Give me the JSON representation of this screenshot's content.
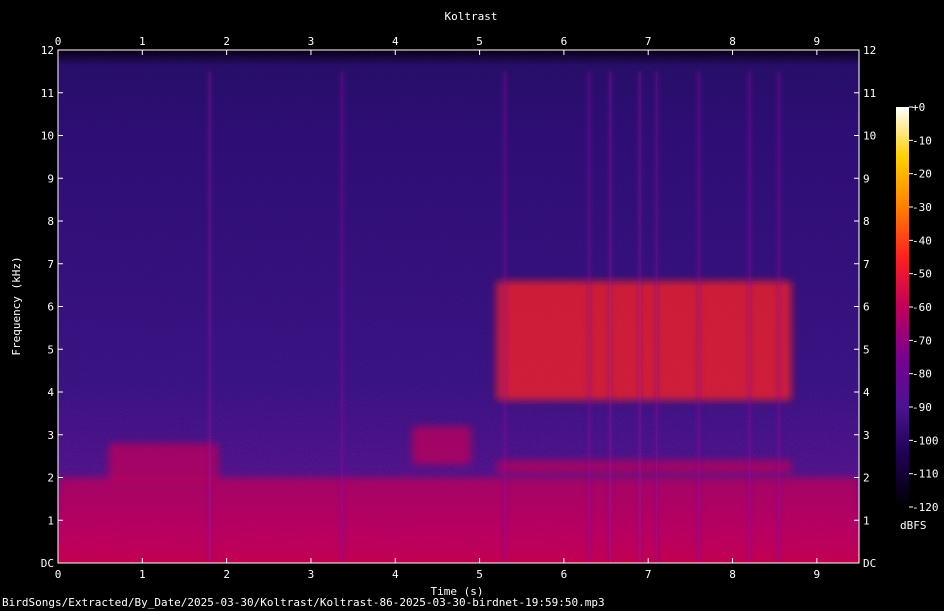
{
  "chart_data": {
    "type": "heatmap",
    "title": "Koltrast",
    "xlabel": "Time (s)",
    "ylabel": "Frequency (kHz)",
    "x_range": [
      0,
      9.5
    ],
    "y_range": [
      0,
      12
    ],
    "x_ticks": [
      "0",
      "1",
      "2",
      "3",
      "4",
      "5",
      "6",
      "7",
      "8",
      "9"
    ],
    "y_ticks": [
      "DC",
      "1",
      "2",
      "3",
      "4",
      "5",
      "6",
      "7",
      "8",
      "9",
      "10",
      "11",
      "12"
    ],
    "colorbar": {
      "label": "dBFS",
      "range": [
        -120,
        0
      ],
      "ticks": [
        "+0",
        "-10",
        "-20",
        "-30",
        "-40",
        "-50",
        "-60",
        "-70",
        "-80",
        "-90",
        "-100",
        "-110",
        "-120"
      ],
      "colors": [
        "#000000",
        "#1e0050",
        "#4a1390",
        "#7a0090",
        "#c0005a",
        "#ff2020",
        "#ff8000",
        "#ffd000",
        "#ffffff"
      ]
    },
    "annotations": [
      {
        "x": [
          0.6,
          1.9
        ],
        "y": [
          1.9,
          2.8
        ],
        "level_dbfs": -60
      },
      {
        "x": [
          4.2,
          4.9
        ],
        "y": [
          2.3,
          3.2
        ],
        "level_dbfs": -65
      },
      {
        "x": [
          5.2,
          8.7
        ],
        "y": [
          3.8,
          6.6
        ],
        "level_dbfs": -45
      },
      {
        "x": [
          5.2,
          8.7
        ],
        "y": [
          2.1,
          2.4
        ],
        "level_dbfs": -60
      },
      {
        "x": [
          0,
          9.5
        ],
        "y": [
          0,
          2.0
        ],
        "level_dbfs": -65
      }
    ],
    "transients_s": [
      1.8,
      3.37,
      5.3,
      6.3,
      6.55,
      6.9,
      7.1,
      7.6,
      8.2,
      8.55
    ],
    "grid": false
  },
  "footer": {
    "filepath": "BirdSongs/Extracted/By_Date/2025-03-30/Koltrast/Koltrast-86-2025-03-30-birdnet-19:59:50.mp3"
  }
}
